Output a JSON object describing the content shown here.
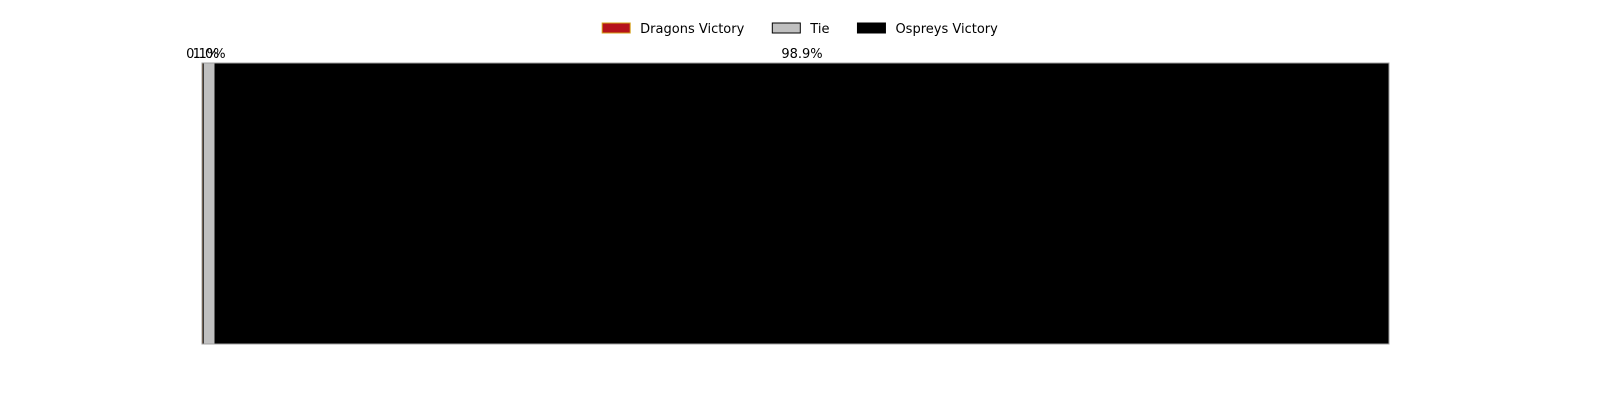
{
  "chart_data": {
    "type": "bar",
    "orientation": "horizontal",
    "stacked": true,
    "series": [
      {
        "name": "Dragons Victory",
        "value": 0.1,
        "label": "0.1%",
        "color": "#b5121b",
        "edge": "#d4a017"
      },
      {
        "name": "Tie",
        "value": 1.0,
        "label": "1.0%",
        "color": "#c0c0c0",
        "edge": "#000000"
      },
      {
        "name": "Ospreys Victory",
        "value": 98.9,
        "label": "98.9%",
        "color": "#000000",
        "edge": "#000000"
      }
    ],
    "xlim": [
      0,
      100
    ],
    "grid": false,
    "axes_visible": false,
    "legend_position": "top-center"
  }
}
